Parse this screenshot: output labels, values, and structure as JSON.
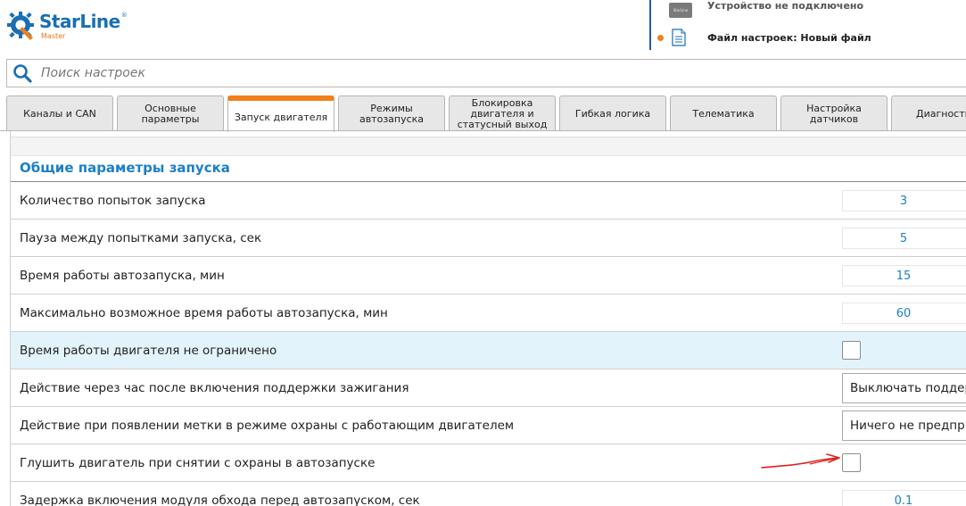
{
  "app": {
    "logo_main": "StarLine",
    "logo_tm": "®",
    "logo_sub": "Master",
    "device_chip_text": "StarLine",
    "device_status": "Устройство не подключено",
    "file_label": "Файл настроек: Новый файл",
    "status_dot_color": "#f0811a"
  },
  "search": {
    "placeholder": "Поиск настроек",
    "value": ""
  },
  "tabs": [
    {
      "label": "Каналы и CAN",
      "active": false
    },
    {
      "label": "Основные параметры",
      "active": false
    },
    {
      "label": "Запуск двигателя",
      "active": true
    },
    {
      "label": "Режимы автозапуска",
      "active": false
    },
    {
      "label": "Блокировка двигателя и статусный выход",
      "active": false
    },
    {
      "label": "Гибкая логика",
      "active": false
    },
    {
      "label": "Телематика",
      "active": false
    },
    {
      "label": "Настройка датчиков",
      "active": false
    },
    {
      "label": "Диагностика",
      "active": false
    }
  ],
  "section": {
    "title": "Общие параметры запуска"
  },
  "rows": [
    {
      "label": "Количество попыток запуска",
      "type": "number",
      "value": "3"
    },
    {
      "label": "Пауза между попытками запуска, сек",
      "type": "number",
      "value": "5"
    },
    {
      "label": "Время работы автозапуска, мин",
      "type": "number",
      "value": "15"
    },
    {
      "label": "Максимально возможное время работы автозапуска, мин",
      "type": "number",
      "value": "60"
    },
    {
      "label": "Время работы двигателя не ограничено",
      "type": "checkbox",
      "checked": false,
      "highlighted": true
    },
    {
      "label": "Действие через час после включения поддержки зажигания",
      "type": "select",
      "value": "Выключать поддержку зажигания"
    },
    {
      "label": "Действие при появлении метки в режиме охраны с работающим двигателем",
      "type": "select",
      "value": "Ничего не предпринимать"
    },
    {
      "label": "Глушить двигатель при снятии с охраны в автозапуске",
      "type": "checkbox",
      "checked": false
    },
    {
      "label": "Задержка включения модуля обхода перед автозапуском, сек",
      "type": "number",
      "value": "0.1"
    }
  ],
  "colors": {
    "accent": "#1c7fc7",
    "active_tab": "#f0811a",
    "highlight_row": "#e3f3fb",
    "annotation_arrow": "#e02020"
  }
}
